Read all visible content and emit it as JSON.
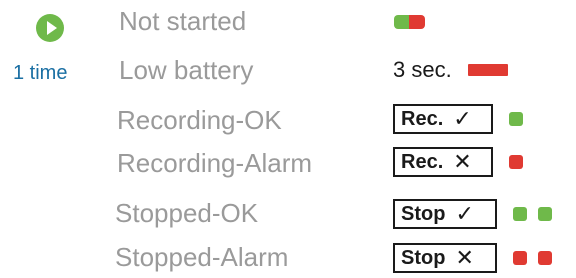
{
  "colors": {
    "green": "#6fb94a",
    "red": "#e03a32",
    "blue": "#1a6fa3"
  },
  "header": {
    "play_icon": "play-icon",
    "times_label": "1 time"
  },
  "states": [
    {
      "label": "Not started"
    },
    {
      "label": "Low battery"
    },
    {
      "label": "Recording-OK"
    },
    {
      "label": "Recording-Alarm"
    },
    {
      "label": "Stopped-OK"
    },
    {
      "label": "Stopped-Alarm"
    }
  ],
  "indicators": {
    "low_battery_text": "3 sec.",
    "rec_ok_label": "Rec.",
    "rec_ok_mark": "✓",
    "rec_alarm_label": "Rec.",
    "rec_alarm_mark": "✕",
    "stop_ok_label": "Stop",
    "stop_ok_mark": "✓",
    "stop_alarm_label": "Stop",
    "stop_alarm_mark": "✕"
  }
}
